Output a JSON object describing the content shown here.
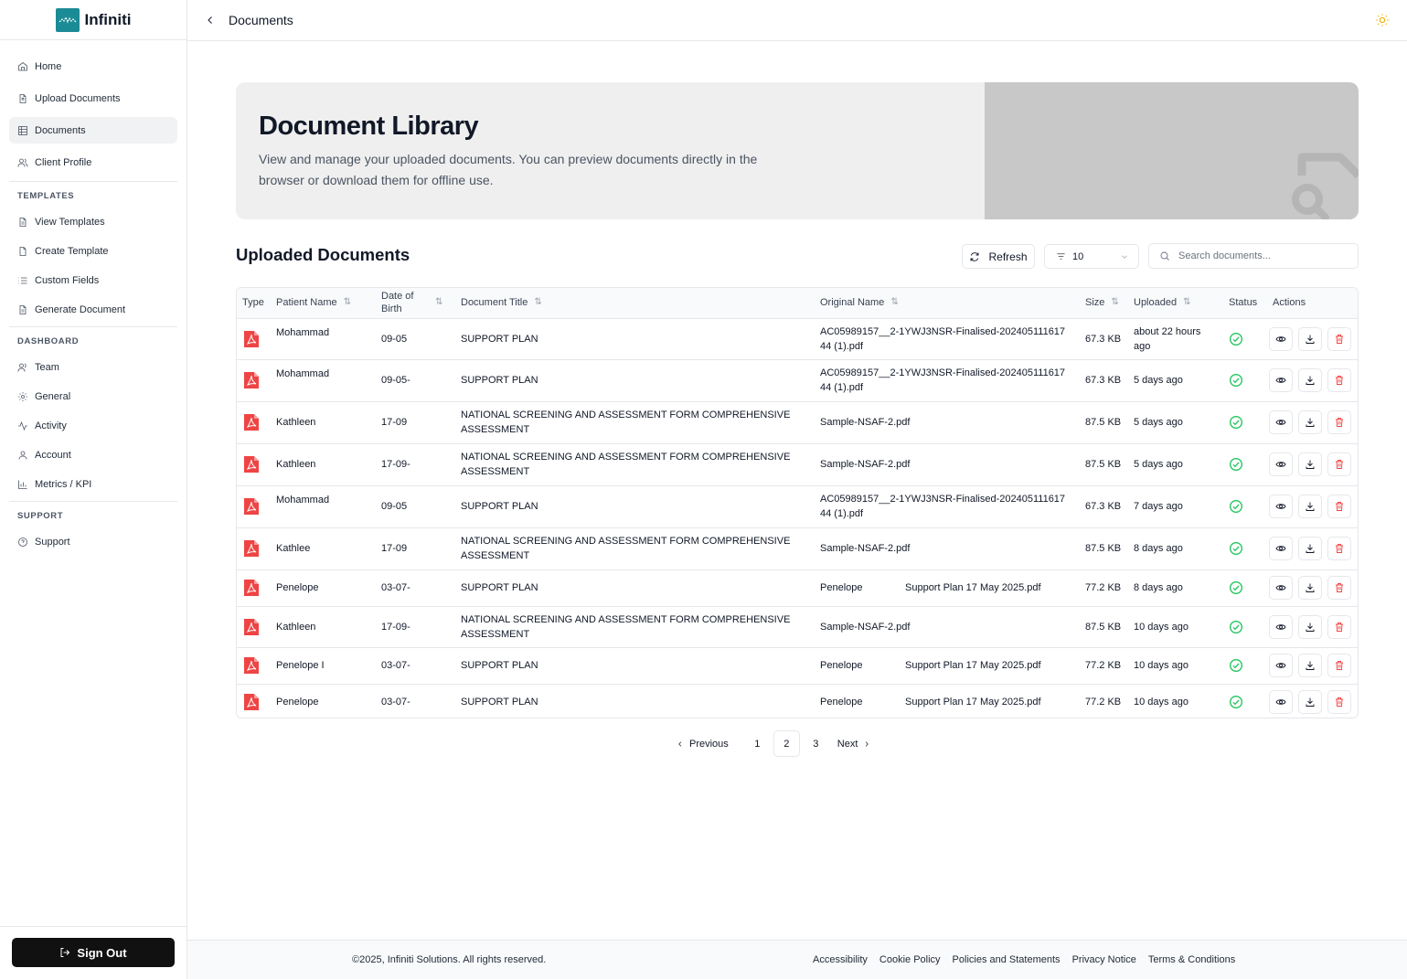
{
  "brand": {
    "name": "Infiniti",
    "color": "#1b8b95"
  },
  "topbar": {
    "title": "Documents"
  },
  "sidebar": {
    "main": [
      {
        "label": "Home",
        "icon": "home-icon"
      },
      {
        "label": "Upload Documents",
        "icon": "file-upload-icon"
      },
      {
        "label": "Documents",
        "icon": "table-icon",
        "active": true
      },
      {
        "label": "Client Profile",
        "icon": "users-icon"
      }
    ],
    "templates_title": "TEMPLATES",
    "templates": [
      {
        "label": "View Templates",
        "icon": "file-text-icon"
      },
      {
        "label": "Create Template",
        "icon": "file-icon"
      },
      {
        "label": "Custom Fields",
        "icon": "list-icon"
      },
      {
        "label": "Generate Document",
        "icon": "file-text-icon"
      }
    ],
    "dashboard_title": "DASHBOARD",
    "dashboard": [
      {
        "label": "Team",
        "icon": "users-icon"
      },
      {
        "label": "General",
        "icon": "gear-icon"
      },
      {
        "label": "Activity",
        "icon": "activity-icon"
      },
      {
        "label": "Account",
        "icon": "user-icon"
      },
      {
        "label": "Metrics / KPI",
        "icon": "bar-chart-icon"
      }
    ],
    "support_title": "SUPPORT",
    "support": [
      {
        "label": "Support",
        "icon": "help-circle-icon"
      }
    ],
    "signout_label": "Sign Out"
  },
  "hero": {
    "title": "Document Library",
    "description": "View and manage your uploaded documents. You can preview documents directly in the browser or download them for offline use."
  },
  "section": {
    "title": "Uploaded Documents",
    "refresh_label": "Refresh",
    "per_page": "10",
    "search_placeholder": "Search documents..."
  },
  "table": {
    "headers": {
      "type": "Type",
      "patient": "Patient Name",
      "dob": "Date of Birth",
      "title": "Document Title",
      "original": "Original Name",
      "size": "Size",
      "uploaded": "Uploaded",
      "status": "Status",
      "actions": "Actions"
    },
    "rows": [
      {
        "patient": "Mohammad",
        "dob": "09-05",
        "title": "SUPPORT PLAN",
        "original": "AC05989157__2-1YWJ3NSR-Finalised-20240511161744 (1).pdf",
        "size": "67.3 KB",
        "uploaded": "about 22 hours ago"
      },
      {
        "patient": "Mohammad",
        "dob": "09-05-",
        "title": "SUPPORT PLAN",
        "original": "AC05989157__2-1YWJ3NSR-Finalised-20240511161744 (1).pdf",
        "size": "67.3 KB",
        "uploaded": "5 days ago"
      },
      {
        "patient": "Kathleen",
        "dob": "17-09",
        "title": "NATIONAL SCREENING AND ASSESSMENT FORM COMPREHENSIVE ASSESSMENT",
        "original": "Sample-NSAF-2.pdf",
        "size": "87.5 KB",
        "uploaded": "5 days ago"
      },
      {
        "patient": "Kathleen",
        "dob": "17-09-",
        "title": "NATIONAL SCREENING AND ASSESSMENT FORM COMPREHENSIVE ASSESSMENT",
        "original": "Sample-NSAF-2.pdf",
        "size": "87.5 KB",
        "uploaded": "5 days ago"
      },
      {
        "patient": "Mohammad",
        "dob": "09-05",
        "title": "SUPPORT PLAN",
        "original": "AC05989157__2-1YWJ3NSR-Finalised-20240511161744 (1).pdf",
        "size": "67.3 KB",
        "uploaded": "7 days ago"
      },
      {
        "patient": "Kathlee",
        "dob": "17-09",
        "title": "NATIONAL SCREENING AND ASSESSMENT FORM COMPREHENSIVE ASSESSMENT",
        "original": "Sample-NSAF-2.pdf",
        "size": "87.5 KB",
        "uploaded": "8 days ago"
      },
      {
        "patient": "Penelope",
        "dob": "03-07-",
        "title": "SUPPORT PLAN",
        "original_a": "Penelope",
        "original_b": "Support Plan 17 May 2025.pdf",
        "size": "77.2 KB",
        "uploaded": "8 days ago"
      },
      {
        "patient": "Kathleen",
        "dob": "17-09-",
        "title": "NATIONAL SCREENING AND ASSESSMENT FORM COMPREHENSIVE ASSESSMENT",
        "original": "Sample-NSAF-2.pdf",
        "size": "87.5 KB",
        "uploaded": "10 days ago"
      },
      {
        "patient": "Penelope I",
        "dob": "03-07-",
        "title": "SUPPORT PLAN",
        "original_a": "Penelope",
        "original_b": "Support Plan 17 May 2025.pdf",
        "size": "77.2 KB",
        "uploaded": "10 days ago"
      },
      {
        "patient": "Penelope",
        "dob": "03-07-",
        "title": "SUPPORT PLAN",
        "original_a": "Penelope",
        "original_b": "Support Plan 17 May 2025.pdf",
        "size": "77.2 KB",
        "uploaded": "10 days ago"
      }
    ]
  },
  "pagination": {
    "prev": "Previous",
    "pages": [
      "1",
      "2",
      "3"
    ],
    "current": "2",
    "next": "Next"
  },
  "footer": {
    "copyright": "©2025, Infiniti Solutions. All rights reserved.",
    "links": [
      "Accessibility",
      "Cookie Policy",
      "Policies and Statements",
      "Privacy Notice",
      "Terms & Conditions"
    ]
  },
  "colors": {
    "status_ok": "#22c55e",
    "pdf": "#ef4444",
    "delete": "#ef4444"
  }
}
